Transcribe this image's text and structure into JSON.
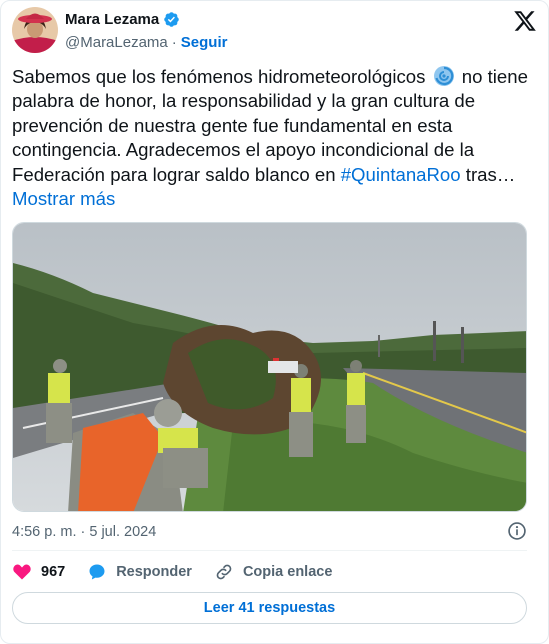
{
  "author": {
    "name": "Mara Lezama",
    "handle": "@MaraLezama",
    "follow_label": "Seguir",
    "separator": "·"
  },
  "tweet": {
    "text_1": "Sabemos que los fenómenos hidrometeorológicos",
    "text_2": " no tiene palabra de honor, la responsabilidad y la gran cultura de prevención de nuestra gente fue fundamental en esta contingencia. Agradecemos el apoyo incondicional de la Federación para lograr saldo blanco en ",
    "hashtag": "#QuintanaRoo",
    "text_3": " tras…",
    "more_label": "Mostrar más"
  },
  "meta": {
    "timestamp": "4:56 p. m. · 5 jul. 2024"
  },
  "actions": {
    "likes_count": "967",
    "reply_label": "Responder",
    "copy_label": "Copia enlace"
  },
  "replies_button": "Leer 41 respuestas",
  "colors": {
    "accent": "#006fd6",
    "like": "#f91880",
    "text": "#0f1419",
    "muted": "#536471"
  },
  "icons": [
    "verified-badge-icon",
    "x-logo-icon",
    "cyclone-emoji-icon",
    "info-icon",
    "heart-icon",
    "reply-bubble-icon",
    "link-icon"
  ]
}
